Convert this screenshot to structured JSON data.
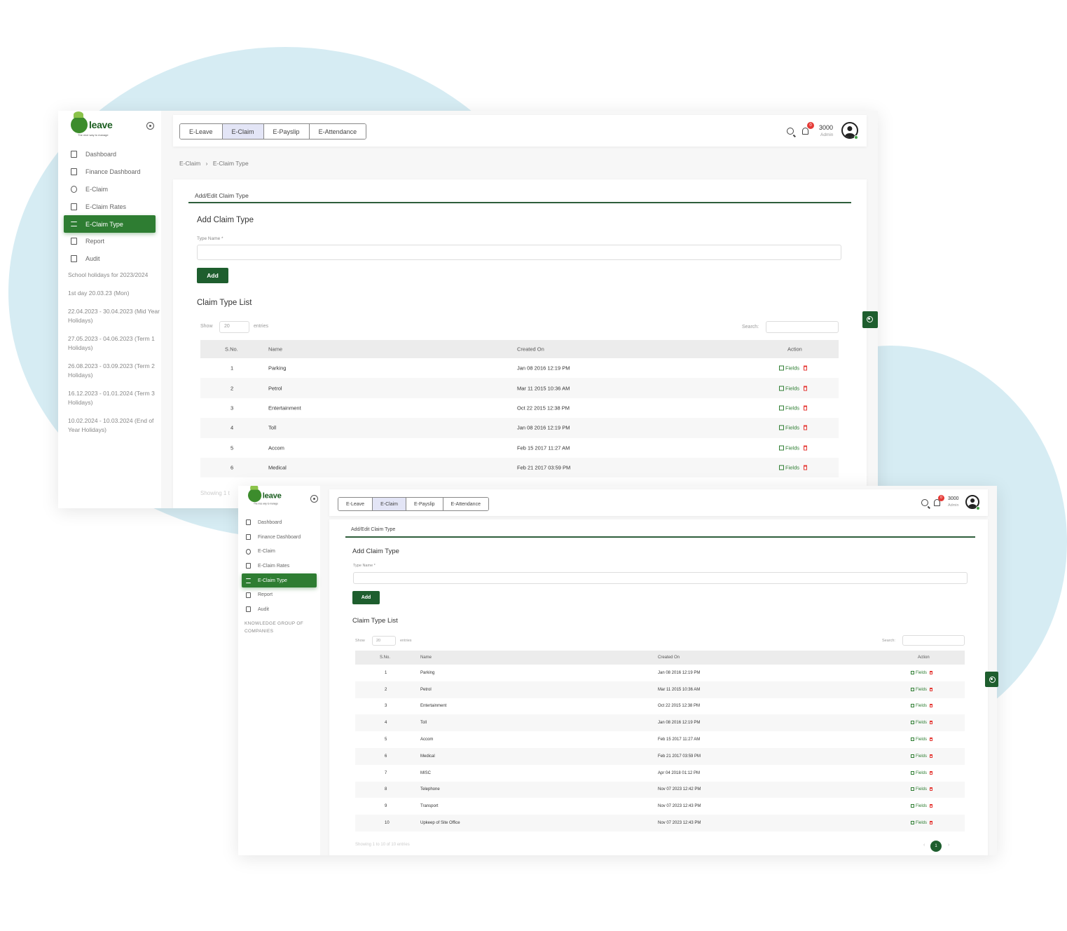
{
  "brand": {
    "logo_word": "leave",
    "logo_mark": "EO",
    "tagline": "The nice way to manage"
  },
  "nav": {
    "items": [
      {
        "label": "Dashboard",
        "icon": "command-icon"
      },
      {
        "label": "Finance Dashboard",
        "icon": "clipboard-icon"
      },
      {
        "label": "E-Claim",
        "icon": "globe-icon"
      },
      {
        "label": "E-Claim Rates",
        "icon": "briefcase-icon"
      },
      {
        "label": "E-Claim Type",
        "icon": "list-icon"
      },
      {
        "label": "Report",
        "icon": "document-icon"
      },
      {
        "label": "Audit",
        "icon": "document-icon"
      }
    ]
  },
  "holidays": [
    "School holidays for 2023/2024",
    "1st day 20.03.23 (Mon)",
    "22.04.2023 - 30.04.2023 (Mid Year Holidays)",
    "27.05.2023 - 04.06.2023 (Term 1 Holidays)",
    "26.08.2023 - 03.09.2023 (Term 2 Holidays)",
    "16.12.2023 - 01.01.2024 (Term 3 Holidays)",
    "10.02.2024 - 10.03.2024 (End of Year Holidays)"
  ],
  "company": "KNOWLEDGE GROUP OF COMPANIES",
  "tabs": [
    "E-Leave",
    "E-Claim",
    "E-Payslip",
    "E-Attendance"
  ],
  "header": {
    "notification_count": "0",
    "user_id": "3000",
    "user_role": "Admin"
  },
  "breadcrumb": [
    "E-Claim",
    "›",
    "E-Claim Type"
  ],
  "form": {
    "card_tab": "Add/Edit Claim Type",
    "title": "Add Claim Type",
    "field_label": "Type Name *",
    "add_label": "Add"
  },
  "list": {
    "title": "Claim Type List",
    "show_label": "Show",
    "page_length": "20",
    "entries_label": "entries",
    "search_label": "Search:",
    "headers": [
      "S.No.",
      "Name",
      "Created On",
      "Action"
    ],
    "action_label": "Fields",
    "rows": [
      {
        "sno": "1",
        "name": "Parking",
        "created": "Jan 08 2016 12:19 PM"
      },
      {
        "sno": "2",
        "name": "Petrol",
        "created": "Mar 11 2015 10:36 AM"
      },
      {
        "sno": "3",
        "name": "Entertainment",
        "created": "Oct 22 2015 12:38 PM"
      },
      {
        "sno": "4",
        "name": "Toll",
        "created": "Jan 08 2016 12:19 PM"
      },
      {
        "sno": "5",
        "name": "Accom",
        "created": "Feb 15 2017 11:27 AM"
      },
      {
        "sno": "6",
        "name": "Medical",
        "created": "Feb 21 2017 03:59 PM"
      },
      {
        "sno": "7",
        "name": "MISC",
        "created": "Apr 04 2018 01:12 PM"
      },
      {
        "sno": "8",
        "name": "Telephone",
        "created": "Nov 07 2023 12:42 PM"
      },
      {
        "sno": "9",
        "name": "Transport",
        "created": "Nov 07 2023 12:43 PM"
      },
      {
        "sno": "10",
        "name": "Upkeep of Site Office",
        "created": "Nov 07 2023 12:43 PM"
      }
    ],
    "showing_partial": "Showing 1 t",
    "showing": "Showing 1 to 10 of 10 entries",
    "current_page": "1",
    "prev": "‹",
    "next": "›"
  },
  "colors": {
    "brand_green": "#1e5e2e",
    "active_tab": "#e3e5f6",
    "backdrop": "#d6ecf3",
    "badge": "#e53935"
  }
}
